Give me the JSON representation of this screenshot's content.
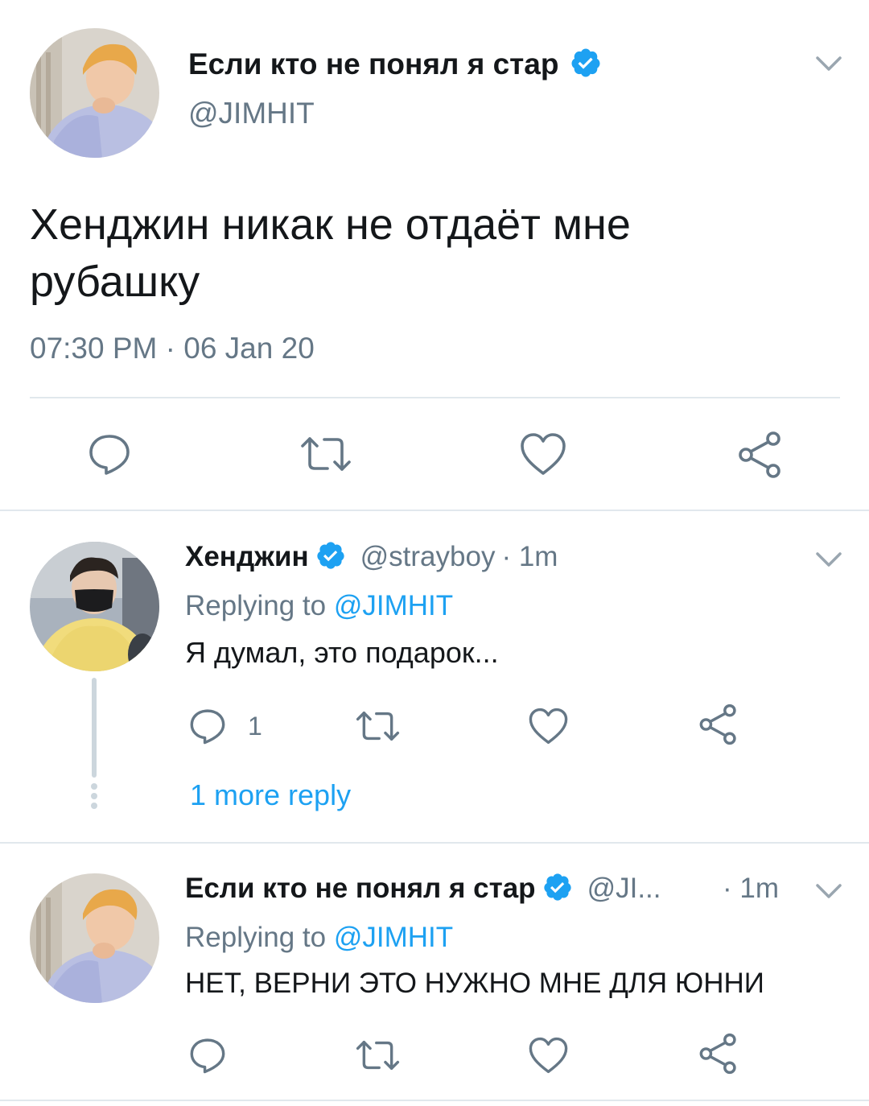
{
  "main_tweet": {
    "display_name": "Если кто не понял я стар",
    "handle": "@JIMHIT",
    "text_line1": "Хенджин никак не отдаёт мне",
    "text_line2": "рубашку",
    "timestamp": "07:30 PM · 06 Jan 20",
    "icons": [
      "reply-icon",
      "retweet-icon",
      "like-icon",
      "share-icon"
    ]
  },
  "reply1": {
    "display_name": "Хенджин",
    "handle": "@strayboy",
    "time": "· 1m",
    "replying_prefix": "Replying to",
    "replying_to": "@JIMHIT",
    "text": "Я думал, это подарок...",
    "reply_count": "1",
    "more_replies": "1 more reply"
  },
  "reply2": {
    "display_name": "Если кто не понял я стар",
    "handle": "@JI...",
    "time": "· 1m",
    "replying_prefix": "Replying to",
    "replying_to": "@JIMHIT",
    "text": "НЕТ, ВЕРНИ ЭТО НУЖНО МНЕ ДЛЯ ЮННИ"
  },
  "colors": {
    "accent": "#1da1f2",
    "text": "#14171a",
    "secondary": "#657786",
    "divider": "#e1e8ed"
  }
}
